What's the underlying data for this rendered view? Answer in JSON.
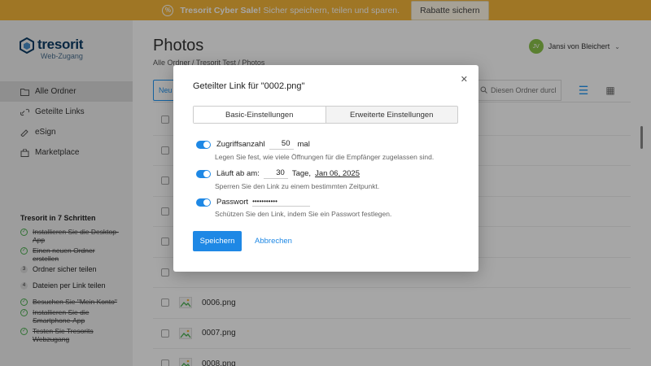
{
  "banner": {
    "icon": "percent-icon",
    "brand_text": "Tresorit Cyber Sale!",
    "message": "Sicher speichern, teilen und sparen.",
    "button_label": "Rabatte sichern"
  },
  "sidebar": {
    "logo_name": "tresorit",
    "logo_sub": "Web-Zugang",
    "items": [
      {
        "label": "Alle Ordner",
        "icon": "folder-icon",
        "active": true
      },
      {
        "label": "Geteilte Links",
        "icon": "link-icon",
        "active": false
      },
      {
        "label": "eSign",
        "icon": "signature-icon",
        "active": false
      },
      {
        "label": "Marketplace",
        "icon": "bag-icon",
        "active": false
      }
    ],
    "steps_title": "Tresorit in 7 Schritten",
    "steps": [
      {
        "label": "Installieren Sie die Desktop-App",
        "status": "done",
        "marker": "✓"
      },
      {
        "label": "Einen neuen Ordner erstellen",
        "status": "done",
        "marker": "✓"
      },
      {
        "label": "Ordner sicher teilen",
        "status": "open",
        "marker": "3"
      },
      {
        "label": "Dateien per Link teilen",
        "status": "open",
        "marker": "4"
      },
      {
        "label": "Besuchen Sie \"Mein Konto\"",
        "status": "done",
        "marker": "✓"
      },
      {
        "label": "Installieren Sie die Smartphone-App",
        "status": "done",
        "marker": "✓"
      },
      {
        "label": "Testen Sie Tresorits Webzugang",
        "status": "done",
        "marker": "✓"
      }
    ]
  },
  "main": {
    "title": "Photos",
    "breadcrumb": "Alle Ordner / Tresorit Test / Photos",
    "user_name": "Jansi von Bleichert",
    "user_initials": "JV",
    "new_label": "Neu",
    "search_placeholder": "Diesen Ordner durcl",
    "files": [
      "",
      "",
      "",
      "",
      "",
      "",
      "0006.png",
      "0007.png",
      "0008.png"
    ]
  },
  "modal": {
    "title": "Geteilter Link für \"0002.png\"",
    "tab_basic": "Basic-Einstellungen",
    "tab_advanced": "Erweiterte Einstellungen",
    "access_label": "Zugriffsanzahl",
    "access_value": "50",
    "access_unit": "mal",
    "access_help": "Legen Sie fest, wie viele Öffnungen für die Empfänger zugelassen sind.",
    "expiry_label": "Läuft ab am:",
    "expiry_value": "30",
    "expiry_unit": "Tage,",
    "expiry_date": "Jan 06, 2025",
    "expiry_help": "Sperren Sie den Link zu einem bestimmten Zeitpunkt.",
    "password_label": "Passwort",
    "password_value": "•••••••••••",
    "password_help": "Schützen Sie den Link, indem Sie ein Passwort festlegen.",
    "save_label": "Speichern",
    "cancel_label": "Abbrechen"
  },
  "colors": {
    "banner": "#f4b53a",
    "primary": "#1e88e5",
    "success": "#4caf50"
  }
}
